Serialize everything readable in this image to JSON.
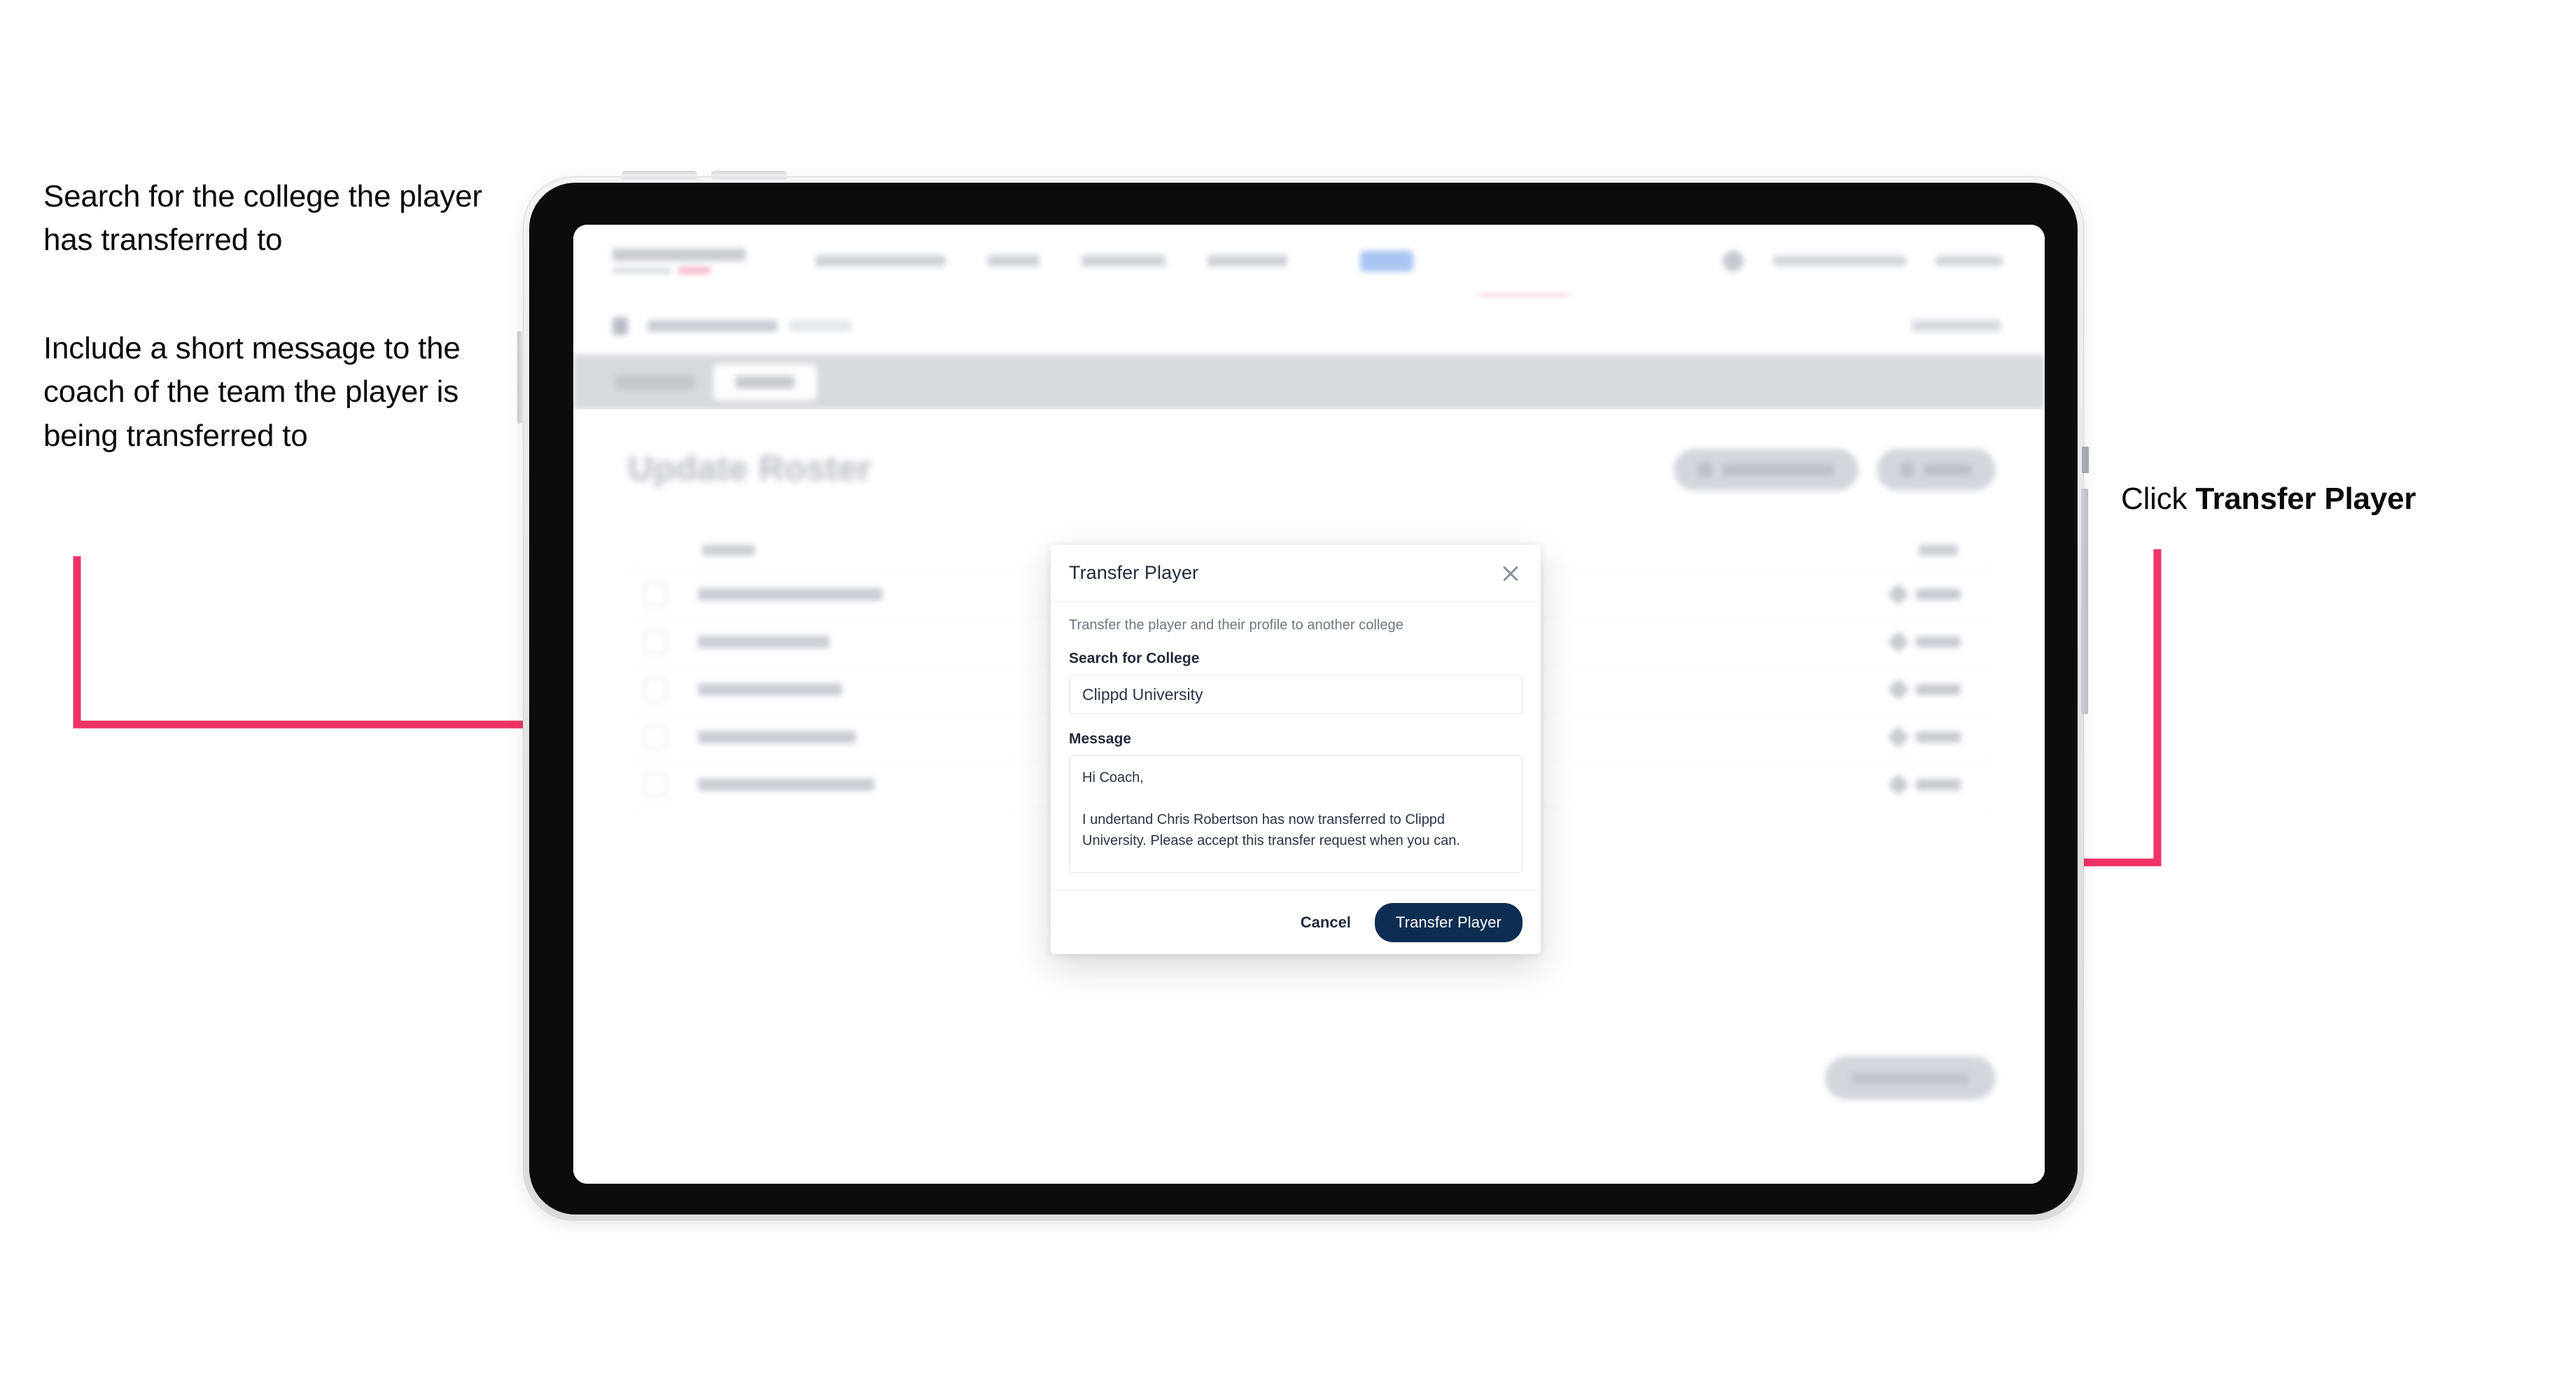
{
  "annotations": {
    "left_top": "Search for the college the player has transferred to",
    "left_bottom": "Include a short message to the coach of the team the player is being transferred to",
    "right_prefix": "Click ",
    "right_bold": "Transfer Player"
  },
  "colors": {
    "arrow_pink": "#ef3366",
    "button_navy": "#0e2d52",
    "device_bezel": "#0c0c0d",
    "device_frame": "#e3e5e7"
  },
  "app": {
    "page_title": "Update Roster",
    "tabs": [
      "Details",
      "Roster"
    ],
    "active_tab": "Roster",
    "header_actions": [
      "Request Player Transfer",
      "Add Player"
    ],
    "table": {
      "columns": [
        "Name",
        "EDIT"
      ],
      "rows": [
        {
          "name": "Chris Robertson",
          "action": "Edit"
        },
        {
          "name": "Ian Walker",
          "action": "Edit"
        },
        {
          "name": "John Taylor",
          "action": "Edit"
        },
        {
          "name": "Lewis Barnes",
          "action": "Edit"
        },
        {
          "name": "Nathan Dobson",
          "action": "Edit"
        }
      ]
    },
    "bottom_cta": "Save Roster Changes"
  },
  "modal": {
    "title": "Transfer Player",
    "close_icon": "close-icon",
    "description": "Transfer the player and their profile to another college",
    "college_label": "Search for College",
    "college_value": "Clippd University",
    "college_placeholder": "Search for College",
    "message_label": "Message",
    "message_value": "Hi Coach,\n\nI undertand Chris Robertson has now transferred to Clippd University. Please accept this transfer request when you can.",
    "message_placeholder": "Message",
    "cancel_label": "Cancel",
    "submit_label": "Transfer Player"
  }
}
